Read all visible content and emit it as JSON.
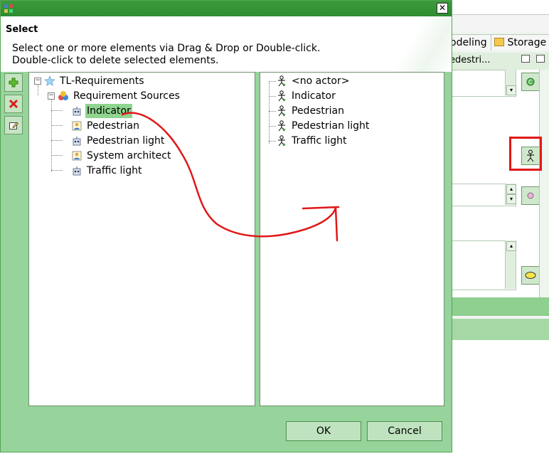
{
  "dialog": {
    "heading": "Select",
    "message_line1": "Select one or more elements via Drag & Drop or Double-click.",
    "message_line2": "Double-click to delete selected elements.",
    "ok_label": "OK",
    "cancel_label": "Cancel"
  },
  "side_toolbar": {
    "items": [
      "add-icon",
      "delete-icon",
      "edit-icon"
    ]
  },
  "left_tree": {
    "root": "TL-Requirements",
    "group": "Requirement Sources",
    "items": [
      {
        "label": "Indicator",
        "icon": "robot-icon",
        "selected": true
      },
      {
        "label": "Pedestrian",
        "icon": "person-edit-icon"
      },
      {
        "label": "Pedestrian light",
        "icon": "robot-icon"
      },
      {
        "label": "System architect",
        "icon": "person-edit-icon"
      },
      {
        "label": "Traffic light",
        "icon": "robot-icon"
      }
    ]
  },
  "right_list": {
    "items": [
      "<no actor>",
      "Indicator",
      "Pedestrian",
      "Pedestrian light",
      "Traffic light"
    ]
  },
  "background_app": {
    "tab_modeling": "odeling",
    "tab_storage": "Storage",
    "subhead": "edestri..."
  },
  "colors": {
    "dialog_bg": "#96d49b",
    "titlebar": "#2f8b2f",
    "selection": "#8fd48f",
    "annotation": "#e01818"
  }
}
